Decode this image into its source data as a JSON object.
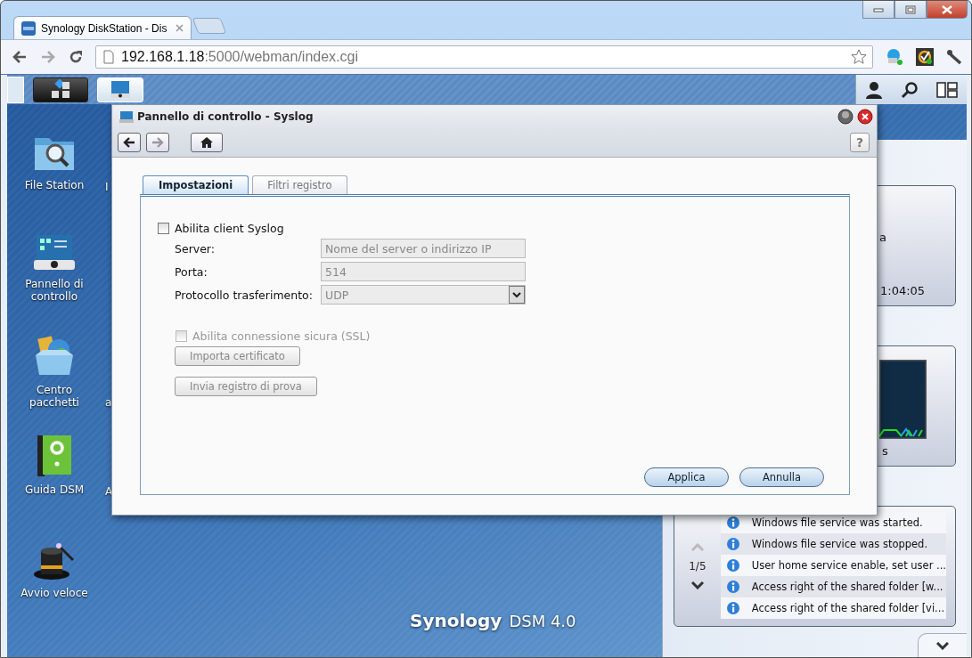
{
  "browser": {
    "tabs": [
      {
        "title": "Synology DiskStation - Dis",
        "selected": true
      }
    ],
    "address": {
      "host": "192.168.1.18",
      "path": ":5000/webman/index.cgi"
    }
  },
  "desktop_icons": [
    {
      "kind": "file-station",
      "label": "File Station"
    },
    {
      "kind": "control-panel",
      "label": "Pannello di controllo"
    },
    {
      "kind": "package-center",
      "label": "Centro pacchetti"
    },
    {
      "kind": "help",
      "label": "Guida DSM"
    },
    {
      "kind": "quick-start",
      "label": "Avvio veloce"
    }
  ],
  "covered_labels": [
    "I",
    "a",
    "A"
  ],
  "dialog": {
    "title": "Pannello di controllo - Syslog",
    "help_button": "?",
    "tabs": [
      {
        "label": "Impostazioni",
        "selected": true
      },
      {
        "label": "Filtri registro",
        "selected": false
      }
    ],
    "enable": {
      "label": "Abilita client Syslog",
      "checked": false
    },
    "fields": [
      {
        "kind": "text",
        "label": "Server:",
        "placeholder": "Nome del server o indirizzo IP",
        "disabled": true
      },
      {
        "kind": "text",
        "label": "Porta:",
        "value": "514",
        "disabled": true
      },
      {
        "kind": "select",
        "label": "Protocollo trasferimento:",
        "value": "UDP",
        "disabled": true
      }
    ],
    "ssl": {
      "label": "Abilita connessione sicura (SSL)",
      "checked": false,
      "disabled": true
    },
    "buttons": [
      {
        "label": "Importa certificato",
        "disabled": true
      },
      {
        "label": "Invia registro di prova",
        "disabled": true
      }
    ],
    "footer_buttons": [
      "Applica",
      "Annulla"
    ]
  },
  "widgets": {
    "card_1": [
      "a",
      "1:04:05"
    ],
    "card_2": [
      "s"
    ]
  },
  "notifications": {
    "page": "1/5",
    "items": [
      "Windows file service was started.",
      "Windows file service was stopped.",
      "User home service enable, set user ...",
      "Access right of the shared folder [w...",
      "Access right of the shared folder [vi..."
    ]
  },
  "logo": {
    "brand": "Synology",
    "product": "DSM 4.0"
  }
}
